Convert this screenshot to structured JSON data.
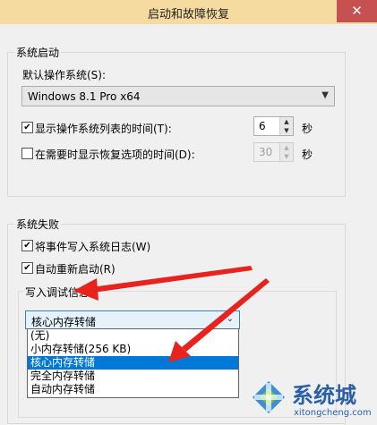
{
  "window": {
    "title": "启动和故障恢复",
    "close_glyph": "✕"
  },
  "system_startup": {
    "group_label": "系统启动",
    "default_os_label": "默认操作系统(S):",
    "default_os_value": "Windows 8.1 Pro x64",
    "show_os_list_label": "显示操作系统列表的时间(T):",
    "show_os_list_checked": true,
    "show_os_list_value": "6",
    "show_recovery_label": "在需要时显示恢复选项的时间(D):",
    "show_recovery_checked": false,
    "show_recovery_value": "30",
    "seconds_unit": "秒"
  },
  "system_failure": {
    "group_label": "系统失败",
    "write_event_label": "将事件写入系统日志(W)",
    "write_event_checked": true,
    "auto_restart_label": "自动重新启动(R)",
    "auto_restart_checked": true,
    "debug_group_label": "写入调试信息",
    "debug_dropdown_value": "核心内存转储",
    "debug_options": [
      "(无)",
      "小内存转储(256 KB)",
      "核心内存转储",
      "完全内存转储",
      "自动内存转储"
    ],
    "debug_selected_index": 2
  },
  "watermark": {
    "brand": "系统城",
    "url": "xitongcheng.com"
  },
  "colors": {
    "title_bar": "#f6dba0",
    "close_button": "#c75050",
    "selection": "#0078d7",
    "annotation_arrow": "#e8231e"
  },
  "icons": [
    "close-icon",
    "dropdown-arrow-icon",
    "checkmark-icon",
    "spin-up-icon",
    "spin-down-icon",
    "annotation-arrow-icon",
    "watermark-logo-icon"
  ]
}
